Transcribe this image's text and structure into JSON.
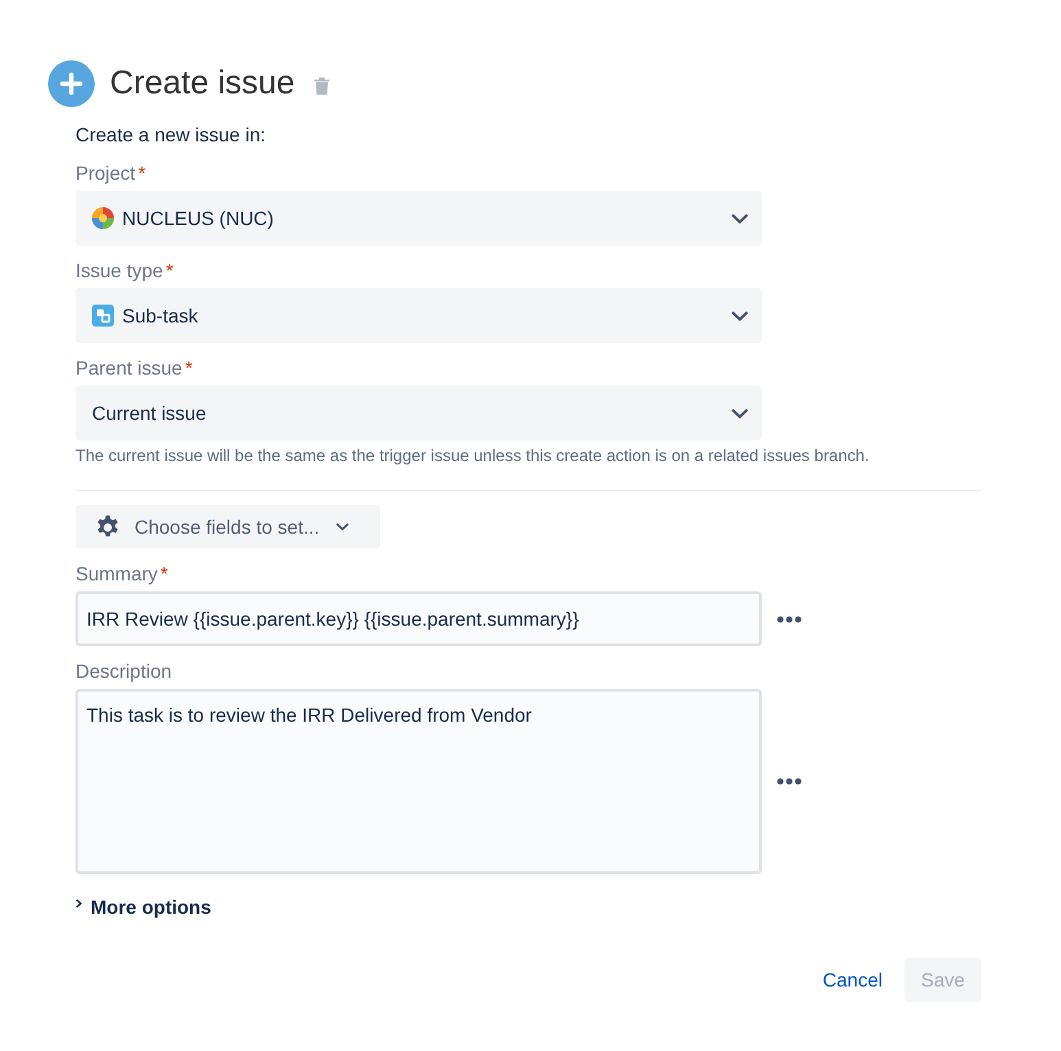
{
  "header": {
    "title": "Create issue"
  },
  "intro": "Create a new issue in:",
  "selects": [
    {
      "label": "Project",
      "required_mark": "*",
      "value": "NUCLEUS (NUC)",
      "kind": "project"
    },
    {
      "label": "Issue type",
      "required_mark": "*",
      "value": "Sub-task",
      "kind": "subtask"
    },
    {
      "label": "Parent issue",
      "required_mark": "*",
      "value": "Current issue",
      "kind": "plain"
    }
  ],
  "parent_help": "The current issue will be the same as the trigger issue unless this create action is on a related issues branch.",
  "choose_fields": {
    "label": "Choose fields to set..."
  },
  "fields": [
    {
      "label": "Summary",
      "required_mark": "*",
      "value": "IRR Review {{issue.parent.key}} {{issue.parent.summary}}",
      "kind": "input"
    },
    {
      "label": "Description",
      "value": "This task is to review the IRR Delivered from Vendor",
      "kind": "textarea"
    }
  ],
  "more_options": {
    "label": "More options",
    "expanded": false
  },
  "actions": [
    {
      "label": "Cancel",
      "kind": "link",
      "disabled": false
    },
    {
      "label": "Save",
      "kind": "button",
      "disabled": true
    }
  ]
}
